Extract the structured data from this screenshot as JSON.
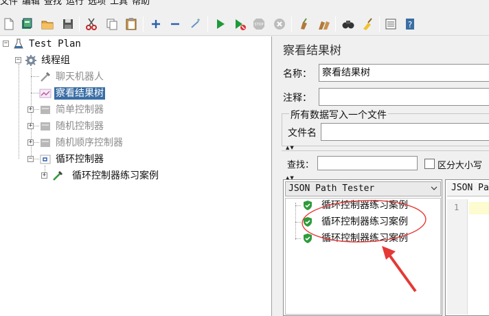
{
  "menu": [
    "文件",
    "编辑",
    "查找",
    "运行",
    "选项",
    "工具",
    "帮助"
  ],
  "toolbar": {
    "icons": [
      "new-icon",
      "templates-icon",
      "open-icon",
      "save-icon",
      "cut-icon",
      "copy-icon",
      "paste-icon",
      "expand-icon",
      "collapse-icon",
      "toggle-icon",
      "start-icon",
      "start-no-pause-icon",
      "stop-icon",
      "shutdown-icon",
      "clear-icon",
      "clear-all-icon",
      "search-icon",
      "reset-search-icon",
      "function-helper-icon",
      "help-icon"
    ]
  },
  "tree": {
    "test_plan": "Test Plan",
    "thread_group": "线程组",
    "chat_robot": "聊天机器人",
    "view_results_tree": "察看结果树",
    "simple_controller": "简单控制器",
    "random_controller": "随机控制器",
    "random_order_controller": "随机顺序控制器",
    "loop_controller": "循环控制器",
    "loop_sample": "循环控制器练习案例"
  },
  "panel": {
    "title": "察看结果树",
    "name_label": "名称：",
    "name_value": "察看结果树",
    "comment_label": "注释：",
    "comment_value": "",
    "file_group_title": "所有数据写入一个文件",
    "filename_label": "文件名",
    "filename_value": "",
    "search_label": "查找：",
    "search_value": "",
    "case_sensitive_label": "区分大小写"
  },
  "results": {
    "renderer": "JSON Path Tester",
    "items": [
      "循环控制器练习案例",
      "循环控制器练习案例",
      "循环控制器练习案例"
    ]
  },
  "tester": {
    "tab_label": "JSON Pa",
    "line_number": "1"
  },
  "colors": {
    "selection": "#3a6ea5",
    "success_shield": "#2e9b3a",
    "annotation_red": "#e53935"
  }
}
